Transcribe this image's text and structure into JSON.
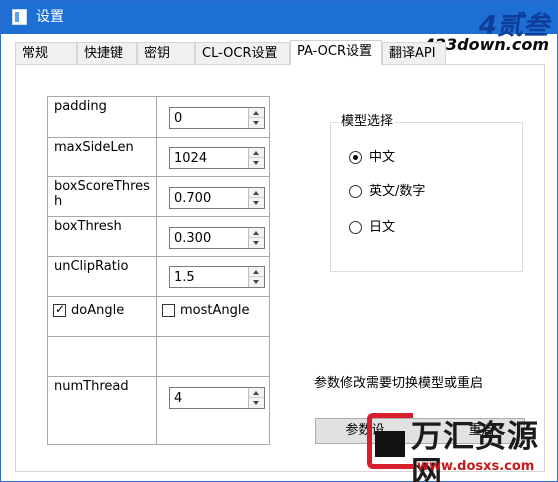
{
  "window": {
    "title": "设置"
  },
  "tabs": [
    {
      "label": "常规"
    },
    {
      "label": "快捷键"
    },
    {
      "label": "密钥"
    },
    {
      "label": "CL-OCR设置"
    },
    {
      "label": "PA-OCR设置"
    },
    {
      "label": "翻译API"
    }
  ],
  "active_tab": "PA-OCR设置",
  "params": [
    {
      "label": "padding",
      "value": "0"
    },
    {
      "label": "maxSideLen",
      "value": "1024"
    },
    {
      "label": "boxScoreThresh",
      "value": "0.700"
    },
    {
      "label": "boxThresh",
      "value": "0.300"
    },
    {
      "label": "unClipRatio",
      "value": "1.5"
    },
    {
      "label": "numThread",
      "value": "4"
    }
  ],
  "checkboxes": {
    "doAngle": {
      "label": "doAngle",
      "checked": true
    },
    "mostAngle": {
      "label": "mostAngle",
      "checked": false
    }
  },
  "model_group": {
    "title": "模型选择",
    "options": [
      {
        "label": "中文",
        "selected": true
      },
      {
        "label": "英文/数字",
        "selected": false
      },
      {
        "label": "日文",
        "selected": false
      }
    ]
  },
  "note": "参数修改需要切换模型或重启",
  "button_visible_parts": [
    "参数设",
    "重启"
  ],
  "watermarks": {
    "top_right_big": "4贰叁",
    "top_right_site": "423down.com",
    "bottom_brand": "万汇资源网",
    "bottom_url": "www.dosxs.com"
  },
  "colors": {
    "titlebar": "#1d6fd6",
    "watermark_red": "#d81e2c"
  }
}
